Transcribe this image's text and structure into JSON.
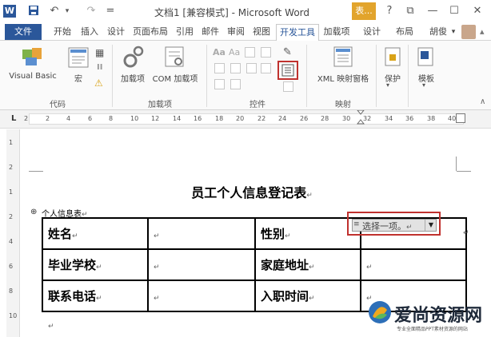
{
  "titlebar": {
    "title": "文档1 [兼容模式] - Microsoft Word",
    "table_tools": "表...",
    "help": "?",
    "restore": "⧉",
    "minimize": "—",
    "maximize": "☐",
    "close": "✕",
    "word_icon": "W",
    "save_icon": "💾",
    "undo_icon": "↶",
    "undo_more": "▾",
    "redo_icon": "↷",
    "qa_more": "="
  },
  "tabs": {
    "file": "文件",
    "home": "开始",
    "insert": "插入",
    "design": "设计",
    "layout": "页面布局",
    "references": "引用",
    "mailings": "邮件",
    "review": "审阅",
    "view": "视图",
    "developer": "开发工具",
    "addins": "加载项",
    "table_design": "设计",
    "table_layout": "布局",
    "user": "胡俊",
    "user_more": "▾"
  },
  "ribbon": {
    "code": {
      "label": "代码",
      "visual_basic": "Visual Basic",
      "macros": "宏",
      "record_macro_icon": "▦",
      "pause_icon": "II",
      "warning_icon": "⚠"
    },
    "addins": {
      "label": "加载项",
      "addins_btn": "加载项",
      "com_addins_btn": "COM 加载项"
    },
    "controls": {
      "label": "控件",
      "icon_aa1": "Aa",
      "icon_aa2": "Aa",
      "design_mode_icon": "✎"
    },
    "mapping": {
      "label": "映射",
      "xml_pane": "XML 映射窗格"
    },
    "protect": {
      "label": "保护"
    },
    "templates": {
      "label": "模板"
    }
  },
  "ruler": {
    "ticks": [
      "2",
      "2",
      "4",
      "6",
      "8",
      "10",
      "12",
      "14",
      "16",
      "18",
      "20",
      "22",
      "24",
      "26",
      "28",
      "30",
      "32",
      "34",
      "36",
      "38",
      "40"
    ],
    "corner_icon": "L",
    "vticks": [
      "1",
      "2",
      "1",
      "2",
      "4",
      "6",
      "8",
      "10"
    ]
  },
  "document": {
    "title": "员工个人信息登记表",
    "title_mark": "↵",
    "caption": "个人信息表",
    "caption_mark": "↵",
    "move_handle_icon": "⊕",
    "table": [
      [
        "姓名",
        "",
        "性别",
        ""
      ],
      [
        "毕业学校",
        "",
        "家庭地址",
        ""
      ],
      [
        "联系电话",
        "",
        "入职时间",
        ""
      ]
    ],
    "cell_mark": "↵",
    "dropdown": {
      "value": "选择一项。",
      "arrow": "▼",
      "handle_icon": "≡",
      "mark": "↵"
    },
    "bottom_mark": "↵"
  },
  "watermark": {
    "text": "爱尚资源网",
    "subtitle": "专业全面精品PPT素材资源的网站"
  },
  "colors": {
    "word_blue": "#2b579a",
    "highlight_red": "#c0312e",
    "table_tools_orange": "#e2a42c"
  }
}
